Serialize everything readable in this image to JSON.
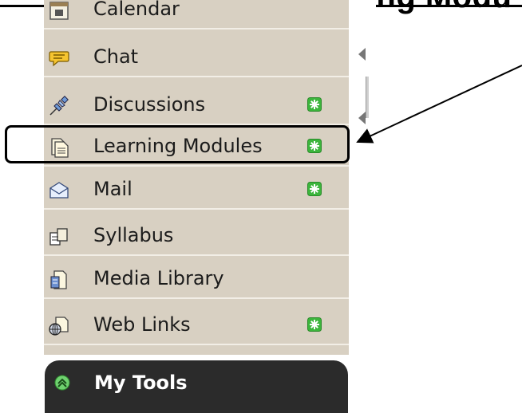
{
  "slide": {
    "heading": "Using the Learning Modu"
  },
  "tools": [
    {
      "label": "Calendar",
      "icon": "calendar-icon",
      "new": false
    },
    {
      "label": "Chat",
      "icon": "chat-icon",
      "new": false
    },
    {
      "label": "Discussions",
      "icon": "pushpin-icon",
      "new": true
    },
    {
      "label": "Learning Modules",
      "icon": "document-icon",
      "new": true
    },
    {
      "label": "Mail",
      "icon": "mail-icon",
      "new": true
    },
    {
      "label": "Syllabus",
      "icon": "syllabus-icon",
      "new": false
    },
    {
      "label": "Media Library",
      "icon": "media-library-icon",
      "new": false
    },
    {
      "label": "Web Links",
      "icon": "web-links-icon",
      "new": true
    }
  ],
  "my_tools": {
    "label": "My Tools"
  },
  "colors": {
    "panel": "#d8d0c2",
    "badge": "#3cb53c",
    "header": "#2b2b2b"
  }
}
